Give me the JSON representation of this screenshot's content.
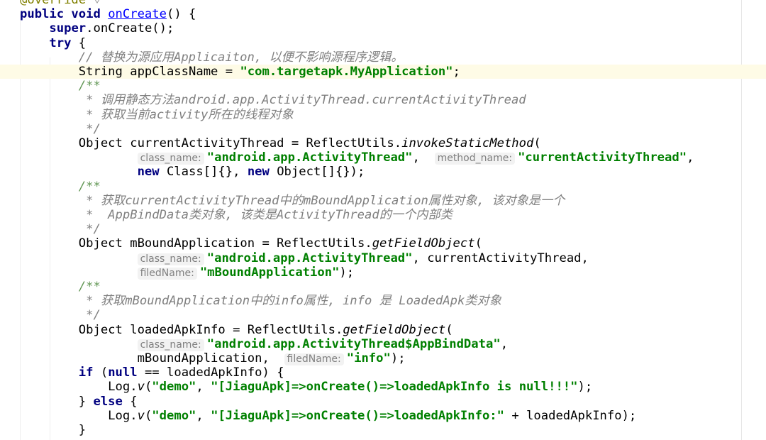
{
  "editor": {
    "lines": [
      {
        "tokens": [
          {
            "c": "ann",
            "t": "@override"
          }
        ],
        "fold": true
      },
      {
        "tokens": [
          {
            "c": "kw",
            "t": "public void "
          },
          {
            "c": "meth",
            "t": "onCreate"
          },
          {
            "c": "",
            "t": "() {"
          }
        ]
      },
      {
        "tokens": [
          {
            "c": "",
            "t": "    "
          },
          {
            "c": "kw",
            "t": "super"
          },
          {
            "c": "",
            "t": ".onCreate();"
          }
        ]
      },
      {
        "tokens": [
          {
            "c": "",
            "t": "    "
          },
          {
            "c": "kw",
            "t": "try"
          },
          {
            "c": "",
            "t": " {"
          }
        ]
      },
      {
        "tokens": [
          {
            "c": "",
            "t": "        "
          },
          {
            "c": "cm",
            "t": "// 替换为源应用Applicaiton, 以便不影响源程序逻辑。"
          }
        ]
      },
      {
        "hl": true,
        "tokens": [
          {
            "c": "",
            "t": "        String appClassName = "
          },
          {
            "c": "str",
            "t": "\"com.targetapk.MyApplication\""
          },
          {
            "c": "",
            "t": ";"
          }
        ]
      },
      {
        "tokens": [
          {
            "c": "",
            "t": "        "
          },
          {
            "c": "docstart",
            "t": "/**"
          }
        ]
      },
      {
        "tokens": [
          {
            "c": "",
            "t": "         "
          },
          {
            "c": "doc",
            "t": "* 调用静态方法android.app.ActivityThread.currentActivityThread"
          }
        ]
      },
      {
        "tokens": [
          {
            "c": "",
            "t": "         "
          },
          {
            "c": "doc",
            "t": "* 获取当前activity所在的线程对象"
          }
        ]
      },
      {
        "tokens": [
          {
            "c": "",
            "t": "         "
          },
          {
            "c": "doc",
            "t": "*/"
          }
        ]
      },
      {
        "tokens": [
          {
            "c": "",
            "t": "        Object currentActivityThread = ReflectUtils."
          },
          {
            "c": "stat",
            "t": "invokeStaticMethod"
          },
          {
            "c": "",
            "t": "("
          }
        ]
      },
      {
        "tokens": [
          {
            "c": "",
            "t": "                "
          },
          {
            "c": "hint",
            "t": "class_name:"
          },
          {
            "c": "str",
            "t": "\"android.app.ActivityThread\""
          },
          {
            "c": "",
            "t": ",  "
          },
          {
            "c": "hint",
            "t": "method_name:"
          },
          {
            "c": "str",
            "t": "\"currentActivityThread\""
          },
          {
            "c": "",
            "t": ","
          }
        ]
      },
      {
        "tokens": [
          {
            "c": "",
            "t": "                "
          },
          {
            "c": "kw",
            "t": "new"
          },
          {
            "c": "",
            "t": " Class[]{}, "
          },
          {
            "c": "kw",
            "t": "new"
          },
          {
            "c": "",
            "t": " Object[]{});"
          }
        ]
      },
      {
        "tokens": [
          {
            "c": "",
            "t": "        "
          },
          {
            "c": "docstart",
            "t": "/**"
          }
        ]
      },
      {
        "tokens": [
          {
            "c": "",
            "t": "         "
          },
          {
            "c": "doc",
            "t": "* 获取currentActivityThread中的mBoundApplication属性对象, 该对象是一个"
          }
        ]
      },
      {
        "tokens": [
          {
            "c": "",
            "t": "         "
          },
          {
            "c": "doc",
            "t": "*  AppBindData类对象, 该类是ActivityThread的一个内部类"
          }
        ]
      },
      {
        "tokens": [
          {
            "c": "",
            "t": "         "
          },
          {
            "c": "doc",
            "t": "*/"
          }
        ]
      },
      {
        "tokens": [
          {
            "c": "",
            "t": "        Object mBoundApplication = ReflectUtils."
          },
          {
            "c": "stat",
            "t": "getFieldObject"
          },
          {
            "c": "",
            "t": "("
          }
        ]
      },
      {
        "tokens": [
          {
            "c": "",
            "t": "                "
          },
          {
            "c": "hint",
            "t": "class_name:"
          },
          {
            "c": "str",
            "t": "\"android.app.ActivityThread\""
          },
          {
            "c": "",
            "t": ", currentActivityThread,"
          }
        ]
      },
      {
        "tokens": [
          {
            "c": "",
            "t": "                "
          },
          {
            "c": "hint",
            "t": "filedName:"
          },
          {
            "c": "str",
            "t": "\"mBoundApplication\""
          },
          {
            "c": "",
            "t": ");"
          }
        ]
      },
      {
        "tokens": [
          {
            "c": "",
            "t": "        "
          },
          {
            "c": "docstart",
            "t": "/**"
          }
        ]
      },
      {
        "tokens": [
          {
            "c": "",
            "t": "         "
          },
          {
            "c": "doc",
            "t": "* 获取mBoundApplication中的info属性, info 是 LoadedApk类对象"
          }
        ]
      },
      {
        "tokens": [
          {
            "c": "",
            "t": "         "
          },
          {
            "c": "doc",
            "t": "*/"
          }
        ]
      },
      {
        "tokens": [
          {
            "c": "",
            "t": "        Object loadedApkInfo = ReflectUtils."
          },
          {
            "c": "stat",
            "t": "getFieldObject"
          },
          {
            "c": "",
            "t": "("
          }
        ]
      },
      {
        "tokens": [
          {
            "c": "",
            "t": "                "
          },
          {
            "c": "hint",
            "t": "class_name:"
          },
          {
            "c": "str",
            "t": "\"android.app.ActivityThread$AppBindData\""
          },
          {
            "c": "",
            "t": ","
          }
        ]
      },
      {
        "tokens": [
          {
            "c": "",
            "t": "                mBoundApplication,  "
          },
          {
            "c": "hint",
            "t": "filedName:"
          },
          {
            "c": "str",
            "t": "\"info\""
          },
          {
            "c": "",
            "t": ");"
          }
        ]
      },
      {
        "tokens": [
          {
            "c": "",
            "t": "        "
          },
          {
            "c": "kw",
            "t": "if"
          },
          {
            "c": "",
            "t": " ("
          },
          {
            "c": "kw",
            "t": "null"
          },
          {
            "c": "",
            "t": " == loadedApkInfo) {"
          }
        ]
      },
      {
        "tokens": [
          {
            "c": "",
            "t": "            Log."
          },
          {
            "c": "stat",
            "t": "v"
          },
          {
            "c": "",
            "t": "("
          },
          {
            "c": "str",
            "t": "\"demo\""
          },
          {
            "c": "",
            "t": ", "
          },
          {
            "c": "str",
            "t": "\"[JiaguApk]=>onCreate()=>loadedApkInfo is null!!!\""
          },
          {
            "c": "",
            "t": ");"
          }
        ]
      },
      {
        "tokens": [
          {
            "c": "",
            "t": "        } "
          },
          {
            "c": "kw",
            "t": "else"
          },
          {
            "c": "",
            "t": " {"
          }
        ]
      },
      {
        "tokens": [
          {
            "c": "",
            "t": "            Log."
          },
          {
            "c": "stat",
            "t": "v"
          },
          {
            "c": "",
            "t": "("
          },
          {
            "c": "str",
            "t": "\"demo\""
          },
          {
            "c": "",
            "t": ", "
          },
          {
            "c": "str",
            "t": "\"[JiaguApk]=>onCreate()=>loadedApkInfo:\""
          },
          {
            "c": "",
            "t": " + loadedApkInfo);"
          }
        ]
      },
      {
        "tokens": [
          {
            "c": "",
            "t": "        }"
          }
        ]
      }
    ]
  }
}
